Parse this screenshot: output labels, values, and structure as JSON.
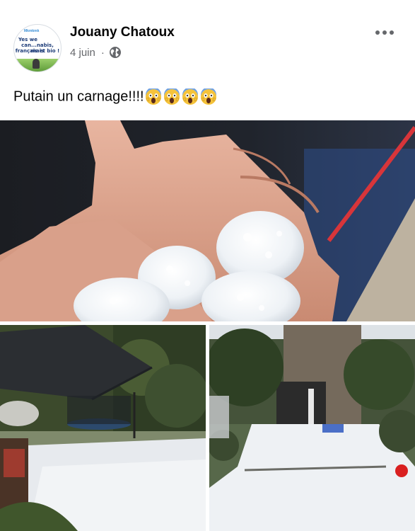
{
  "post": {
    "author": "Jouany Chatoux",
    "date": "4 juin",
    "separator": "·",
    "privacy_icon": "globe-icon",
    "more_icon": "more-options-icon",
    "text": "Putain un carnage!!!!",
    "emoji_icons": [
      "face-screaming-in-fear-icon",
      "face-screaming-in-fear-icon",
      "face-screaming-in-fear-icon",
      "face-screaming-in-fear-icon"
    ]
  },
  "avatar": {
    "brand": "Mkmkmk",
    "line1": "Yes we",
    "line2": "can...nabis, mais",
    "line3": "français et bio !"
  },
  "photos": [
    {
      "name": "hailstones-in-hands-photo"
    },
    {
      "name": "hail-covered-garden-trampoline-photo"
    },
    {
      "name": "hail-covered-backyard-path-photo"
    }
  ],
  "colors": {
    "name_text": "#050505",
    "meta_text": "#65676b",
    "background": "#ffffff"
  }
}
